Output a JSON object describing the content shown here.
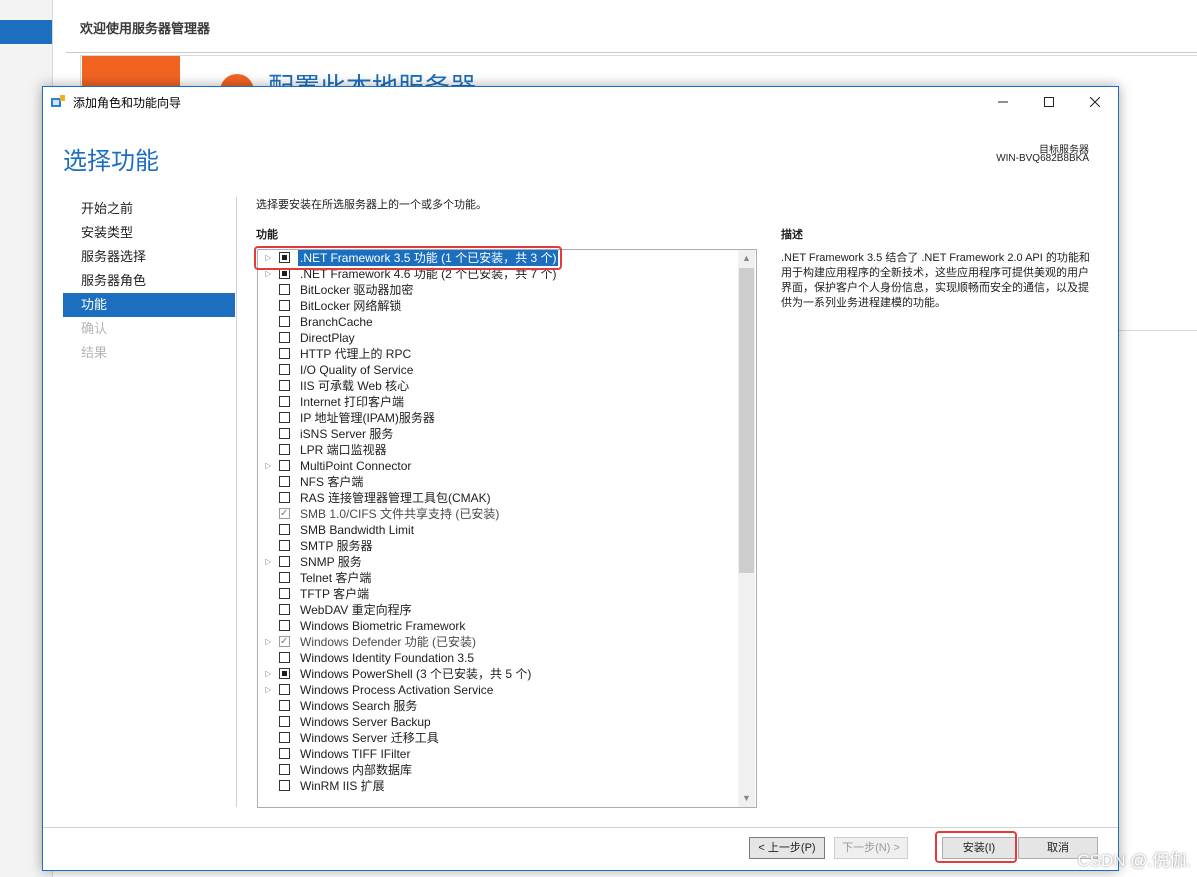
{
  "background": {
    "title": "欢迎使用服务器管理器",
    "heading": "配置此本地服务器"
  },
  "dialog": {
    "window_title": "添加角色和功能向导",
    "page_title": "选择功能",
    "target_label": "目标服务器",
    "target_name": "WIN-BVQ682B8BKA",
    "nav": [
      {
        "label": "开始之前",
        "state": "normal"
      },
      {
        "label": "安装类型",
        "state": "normal"
      },
      {
        "label": "服务器选择",
        "state": "normal"
      },
      {
        "label": "服务器角色",
        "state": "normal"
      },
      {
        "label": "功能",
        "state": "active"
      },
      {
        "label": "确认",
        "state": "disabled"
      },
      {
        "label": "结果",
        "state": "disabled"
      }
    ],
    "instruction": "选择要安装在所选服务器上的一个或多个功能。",
    "features_label": "功能",
    "features": [
      {
        "label": ".NET Framework 3.5 功能 (1 个已安装，共 3 个)",
        "expandable": true,
        "check": "partial",
        "selected": true
      },
      {
        "label": ".NET Framework 4.6 功能 (2 个已安装，共 7 个)",
        "expandable": true,
        "check": "partial"
      },
      {
        "label": "BitLocker 驱动器加密",
        "check": "none"
      },
      {
        "label": "BitLocker 网络解锁",
        "check": "none"
      },
      {
        "label": "BranchCache",
        "check": "none"
      },
      {
        "label": "DirectPlay",
        "check": "none"
      },
      {
        "label": "HTTP 代理上的 RPC",
        "check": "none"
      },
      {
        "label": "I/O Quality of Service",
        "check": "none"
      },
      {
        "label": "IIS 可承载 Web 核心",
        "check": "none"
      },
      {
        "label": "Internet 打印客户端",
        "check": "none"
      },
      {
        "label": "IP 地址管理(IPAM)服务器",
        "check": "none"
      },
      {
        "label": "iSNS Server 服务",
        "check": "none"
      },
      {
        "label": "LPR 端口监视器",
        "check": "none"
      },
      {
        "label": "MultiPoint Connector",
        "expandable": true,
        "check": "none"
      },
      {
        "label": "NFS 客户端",
        "check": "none"
      },
      {
        "label": "RAS 连接管理器管理工具包(CMAK)",
        "check": "none"
      },
      {
        "label": "SMB 1.0/CIFS 文件共享支持 (已安装)",
        "check": "checked"
      },
      {
        "label": "SMB Bandwidth Limit",
        "check": "none"
      },
      {
        "label": "SMTP 服务器",
        "check": "none"
      },
      {
        "label": "SNMP 服务",
        "expandable": true,
        "check": "none"
      },
      {
        "label": "Telnet 客户端",
        "check": "none"
      },
      {
        "label": "TFTP 客户端",
        "check": "none"
      },
      {
        "label": "WebDAV 重定向程序",
        "check": "none"
      },
      {
        "label": "Windows Biometric Framework",
        "check": "none"
      },
      {
        "label": "Windows Defender 功能 (已安装)",
        "expandable": true,
        "check": "checked"
      },
      {
        "label": "Windows Identity Foundation 3.5",
        "check": "none"
      },
      {
        "label": "Windows PowerShell (3 个已安装，共 5 个)",
        "expandable": true,
        "check": "partial"
      },
      {
        "label": "Windows Process Activation Service",
        "expandable": true,
        "check": "none"
      },
      {
        "label": "Windows Search 服务",
        "check": "none"
      },
      {
        "label": "Windows Server Backup",
        "check": "none"
      },
      {
        "label": "Windows Server 迁移工具",
        "check": "none"
      },
      {
        "label": "Windows TIFF IFilter",
        "check": "none"
      },
      {
        "label": "Windows 内部数据库",
        "check": "none"
      },
      {
        "label": "WinRM IIS 扩展",
        "check": "none"
      }
    ],
    "description_label": "描述",
    "description": ".NET Framework 3.5 结合了 .NET Framework 2.0 API 的功能和用于构建应用程序的全新技术，这些应用程序可提供美观的用户界面，保护客户个人身份信息，实现顺畅而安全的通信，以及提供为一系列业务进程建模的功能。",
    "buttons": {
      "prev": "< 上一步(P)",
      "next": "下一步(N) >",
      "install": "安装(I)",
      "cancel": "取消"
    }
  },
  "watermark": "CSDN @.倪伽.",
  "colors": {
    "accent": "#1c6fbf",
    "highlight": "#e03c3c",
    "tile": "#f26322"
  }
}
